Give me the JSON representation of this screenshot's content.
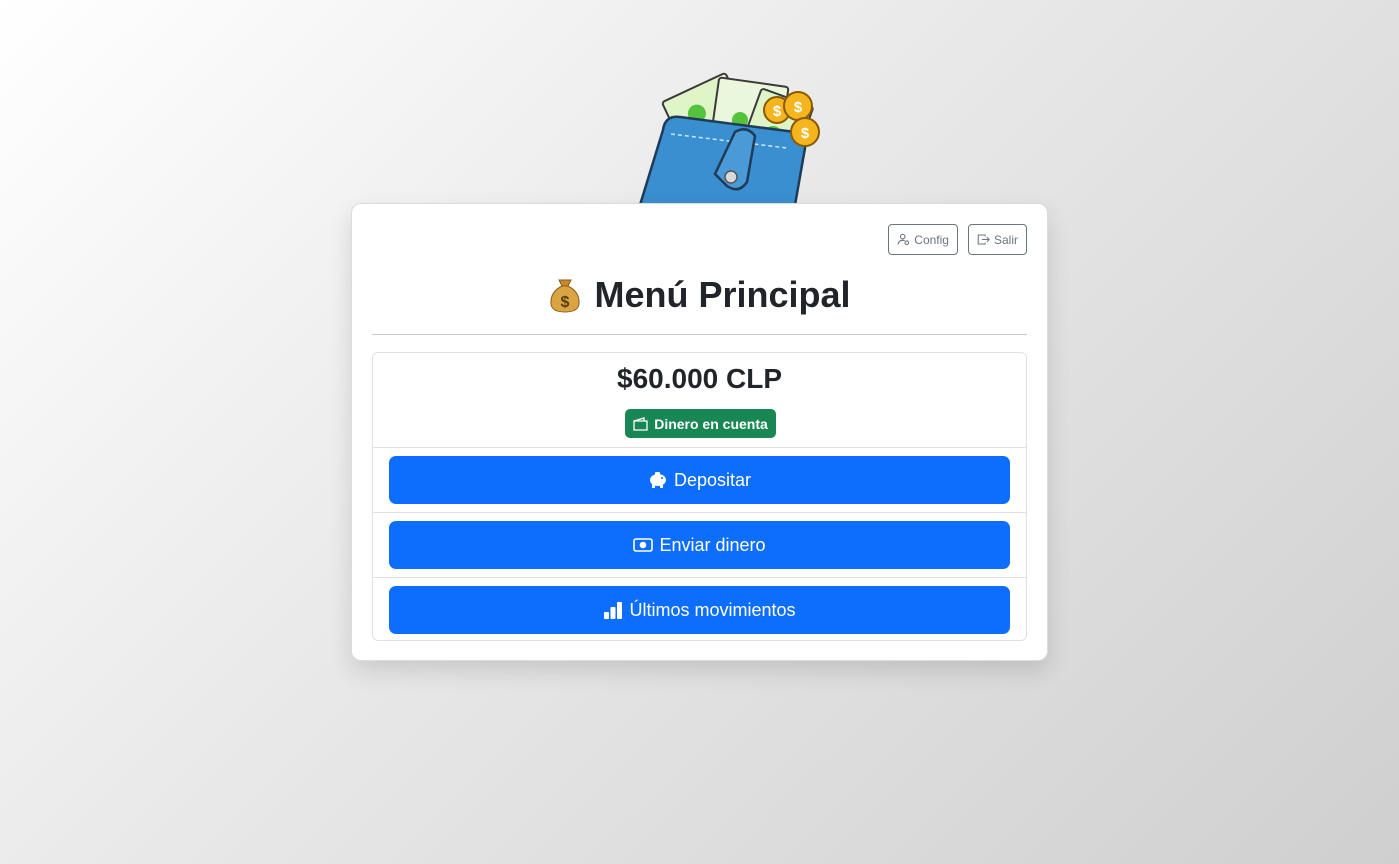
{
  "header": {
    "config_label": "Config",
    "logout_label": "Salir"
  },
  "page": {
    "title": "Menú Principal"
  },
  "balance": {
    "amount": "$60.000 CLP",
    "badge_label": "Dinero en cuenta",
    "badge_color": "#198754"
  },
  "actions": [
    {
      "label": "Depositar",
      "icon": "piggy-bank-icon"
    },
    {
      "label": "Enviar dinero",
      "icon": "cash-icon"
    },
    {
      "label": "Últimos movimientos",
      "icon": "bar-chart-icon"
    }
  ],
  "colors": {
    "primary": "#0d6efd",
    "success": "#198754",
    "secondary": "#6c757d"
  }
}
